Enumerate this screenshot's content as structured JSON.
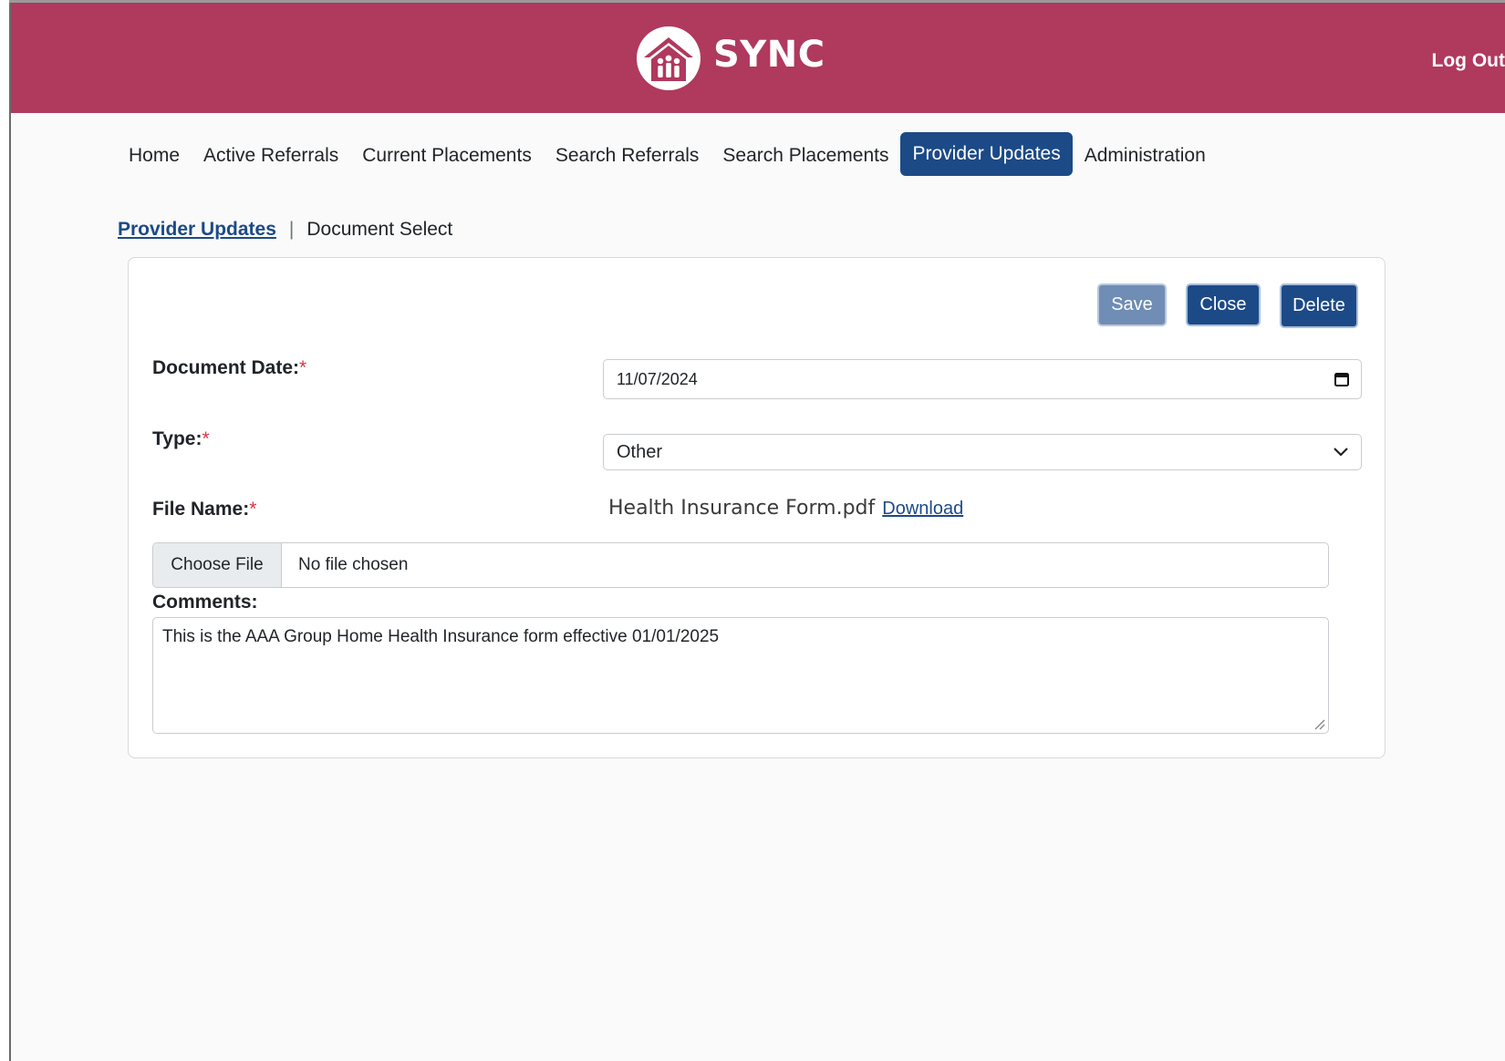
{
  "app": {
    "name": "SYNC",
    "logout_label": "Log Out",
    "brand_color": "#b0395e",
    "accent_color": "#1c4a87"
  },
  "nav": {
    "items": [
      {
        "label": "Home",
        "active": false
      },
      {
        "label": "Active Referrals",
        "active": false
      },
      {
        "label": "Current Placements",
        "active": false
      },
      {
        "label": "Search Referrals",
        "active": false
      },
      {
        "label": "Search Placements",
        "active": false
      },
      {
        "label": "Provider Updates",
        "active": true
      },
      {
        "label": "Administration",
        "active": false
      }
    ]
  },
  "breadcrumb": {
    "parent": "Provider Updates",
    "separator": "|",
    "current": "Document Select"
  },
  "form": {
    "buttons": {
      "save": "Save",
      "close": "Close",
      "delete": "Delete"
    },
    "document_date": {
      "label": "Document Date:",
      "required_mark": "*",
      "value": "11/07/2024",
      "icon": "calendar-icon"
    },
    "type": {
      "label": "Type:",
      "required_mark": "*",
      "value": "Other",
      "icon": "chevron-down-icon"
    },
    "file_name": {
      "label": "File Name:",
      "required_mark": "*",
      "current_file": "Health Insurance Form.pdf",
      "download_label": "Download",
      "choose_label": "Choose File",
      "no_file_text": "No file chosen"
    },
    "comments": {
      "label": "Comments:",
      "value": "This is the AAA Group Home Health Insurance form effective 01/01/2025"
    }
  }
}
